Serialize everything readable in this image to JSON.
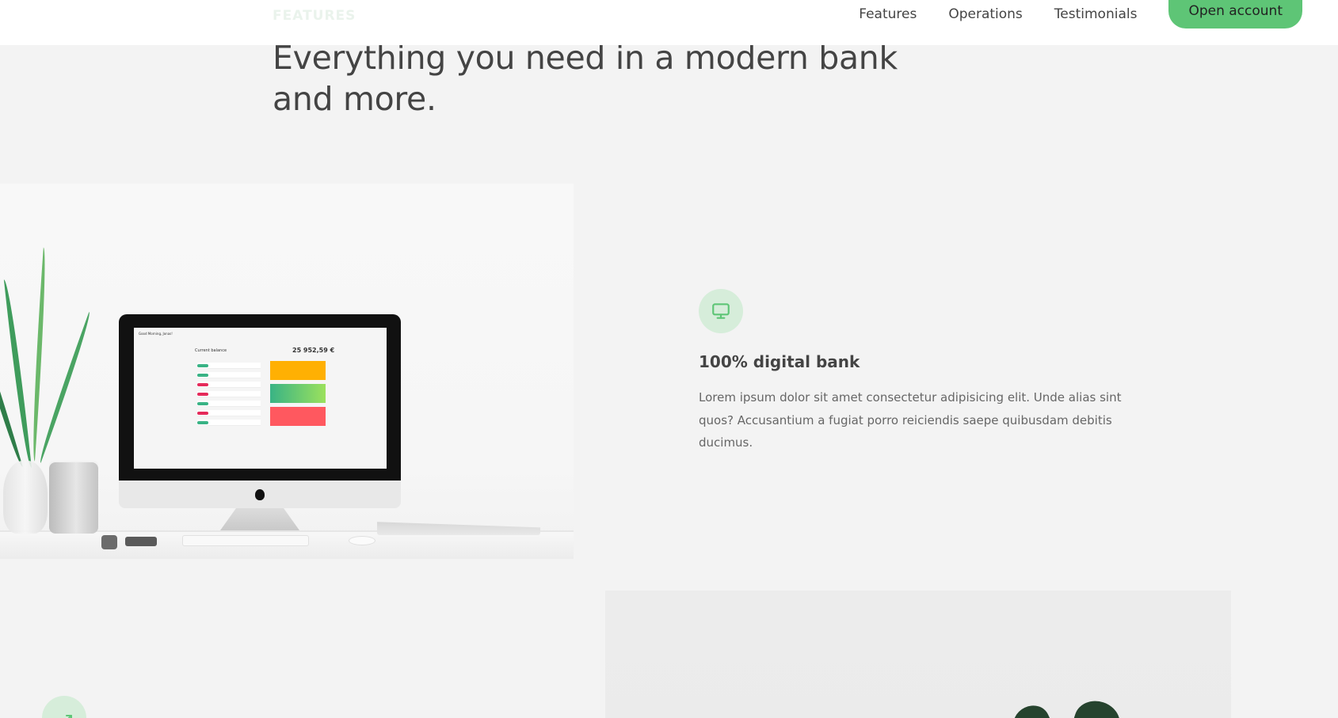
{
  "header": {
    "section_tag": "FEATURES",
    "nav": {
      "links": [
        "Features",
        "Operations",
        "Testimonials"
      ],
      "cta_label": "Open account"
    }
  },
  "section": {
    "headline_line1": "Everything you need in a modern bank",
    "headline_line2": "and more."
  },
  "feature_1": {
    "icon": "monitor-icon",
    "title": "100% digital bank",
    "text": "Lorem ipsum dolor sit amet consectetur adipisicing elit. Unde alias sint quos? Accusantium a fugiat porro reiciendis saepe quibusdam debitis ducimus.",
    "image_screen": {
      "greeting": "Good Morning, Jonas!",
      "current_balance_label": "Current balance",
      "balance": "25 952,59 €"
    }
  },
  "feature_2": {
    "icon": "trending-up-icon"
  },
  "colors": {
    "accent": "#5ec576",
    "accent_light": "#d6edda",
    "background": "#f3f3f3",
    "text": "#444444"
  }
}
